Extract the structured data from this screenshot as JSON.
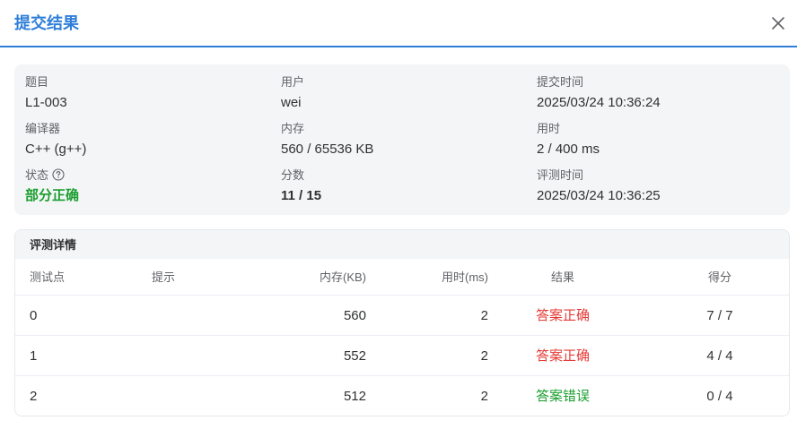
{
  "dialog": {
    "title": "提交结果"
  },
  "summary": {
    "problem_label": "题目",
    "problem_value": "L1-003",
    "user_label": "用户",
    "user_value": "wei",
    "submit_time_label": "提交时间",
    "submit_time_value": "2025/03/24 10:36:24",
    "compiler_label": "编译器",
    "compiler_value": "C++ (g++)",
    "memory_label": "内存",
    "memory_value": "560 / 65536 KB",
    "time_label": "用时",
    "time_value": "2 / 400 ms",
    "status_label": "状态",
    "status_value": "部分正确",
    "score_label": "分数",
    "score_value": "11 / 15",
    "judge_time_label": "评测时间",
    "judge_time_value": "2025/03/24 10:36:25"
  },
  "detail": {
    "title": "评测详情",
    "columns": [
      "测试点",
      "提示",
      "内存(KB)",
      "用时(ms)",
      "结果",
      "得分"
    ],
    "rows": [
      {
        "case": "0",
        "hint": "",
        "memory": "560",
        "time": "2",
        "result": "答案正确",
        "score": "7 / 7"
      },
      {
        "case": "1",
        "hint": "",
        "memory": "552",
        "time": "2",
        "result": "答案正确",
        "score": "4 / 4"
      },
      {
        "case": "2",
        "hint": "",
        "memory": "512",
        "time": "2",
        "result": "答案错误",
        "score": "0 / 4"
      }
    ]
  },
  "colors": {
    "accent": "#2f7fd8",
    "accepted": "#e53935",
    "wrong": "#1a9e2f",
    "partial": "#1a9e2f"
  },
  "icons": {
    "close": "close-icon",
    "help": "question-circle-icon"
  }
}
